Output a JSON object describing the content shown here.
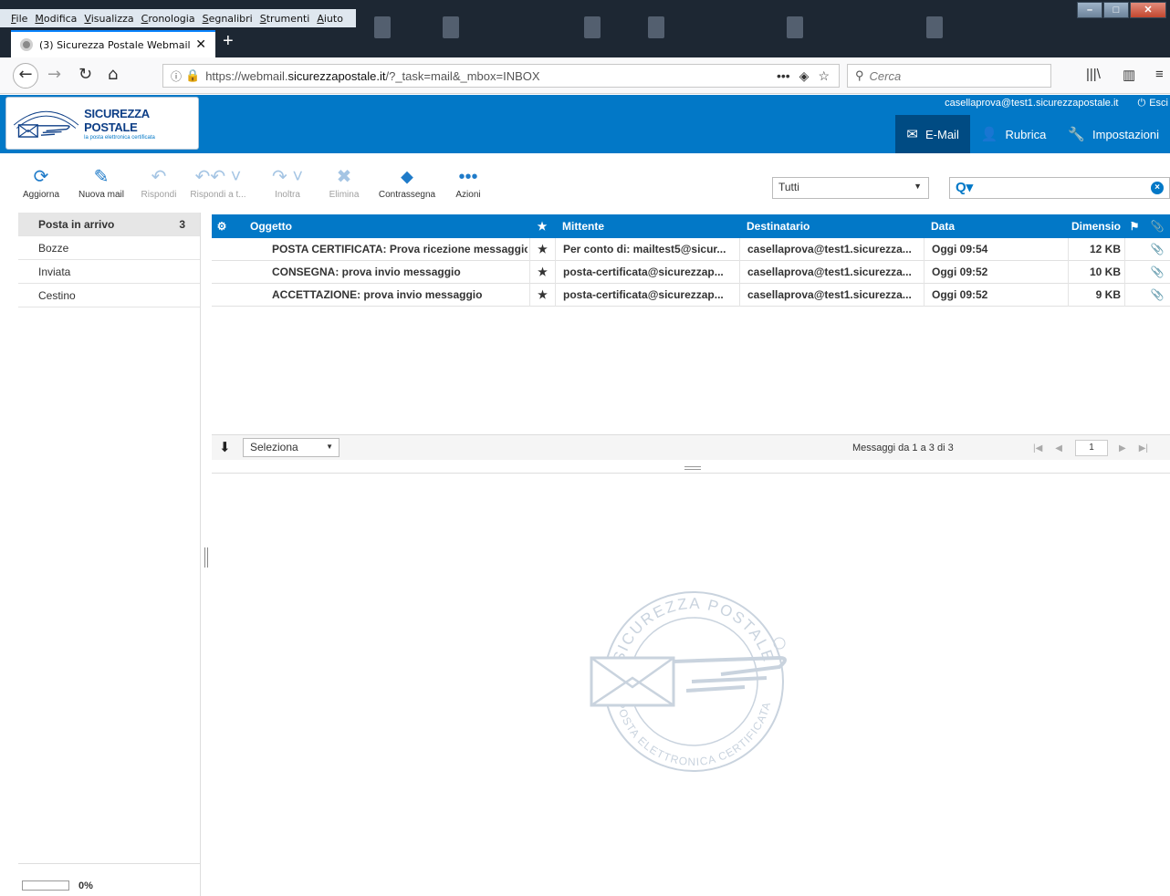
{
  "browser": {
    "menu": [
      "File",
      "Modifica",
      "Visualizza",
      "Cronologia",
      "Segnalibri",
      "Strumenti",
      "Aiuto"
    ],
    "tab_title": "(3) Sicurezza Postale Webmail ::",
    "url_prefix": "https://webmail.",
    "url_domain": "sicurezzapostale.it",
    "url_suffix": "/?_task=mail&_mbox=INBOX",
    "search_placeholder": "Cerca"
  },
  "header": {
    "brand": "SICUREZZA POSTALE",
    "tagline": "la posta elettronica certificata",
    "user_email": "casellaprova@test1.sicurezzapostale.it",
    "logout_label": "Esci",
    "nav": [
      {
        "label": "E-Mail",
        "icon": "envelope-icon",
        "selected": true
      },
      {
        "label": "Rubrica",
        "icon": "person-icon",
        "selected": false
      },
      {
        "label": "Impostazioni",
        "icon": "wrench-icon",
        "selected": false
      }
    ]
  },
  "toolbar": {
    "refresh": "Aggiorna",
    "compose": "Nuova mail",
    "reply": "Rispondi",
    "reply_all": "Rispondi a t...",
    "forward": "Inoltra",
    "delete": "Elimina",
    "mark": "Contrassegna",
    "more": "Azioni",
    "filter_value": "Tutti"
  },
  "folders": [
    {
      "name": "Posta in arrivo",
      "unread": "3",
      "selected": true
    },
    {
      "name": "Bozze",
      "unread": "",
      "selected": false
    },
    {
      "name": "Inviata",
      "unread": "",
      "selected": false
    },
    {
      "name": "Cestino",
      "unread": "",
      "selected": false
    }
  ],
  "quota": {
    "percent_label": "0%",
    "fraction": 0
  },
  "message_list": {
    "columns": {
      "subject": "Oggetto",
      "from": "Mittente",
      "to": "Destinatario",
      "date": "Data",
      "size": "Dimensio"
    },
    "rows": [
      {
        "subject": "POSTA CERTIFICATA: Prova ricezione messaggio",
        "from": "Per conto di: mailtest5@sicur...",
        "to": "casellaprova@test1.sicurezza...",
        "date": "Oggi 09:54",
        "size": "12 KB"
      },
      {
        "subject": "CONSEGNA: prova invio messaggio",
        "from": "posta-certificata@sicurezzap...",
        "to": "casellaprova@test1.sicurezza...",
        "date": "Oggi 09:52",
        "size": "10 KB"
      },
      {
        "subject": "ACCETTAZIONE: prova invio messaggio",
        "from": "posta-certificata@sicurezzap...",
        "to": "casellaprova@test1.sicurezza...",
        "date": "Oggi 09:52",
        "size": "9 KB"
      }
    ],
    "select_label": "Seleziona",
    "count_label": "Messaggi da 1 a 3 di 3",
    "page": "1"
  },
  "watermark": {
    "top_text": "SICUREZZA POSTALE",
    "bottom_text": "POSTA ELETTRONICA CERTIFICATA"
  },
  "colors": {
    "primary": "#0278c7",
    "dark": "#004b83"
  }
}
